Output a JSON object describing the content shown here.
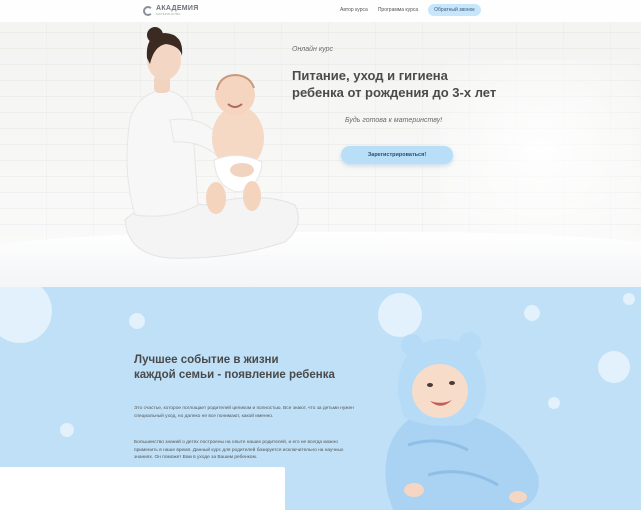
{
  "header": {
    "logo_title": "АКАДЕМИЯ",
    "logo_subtitle": "МАТЕРИНСТВА",
    "nav": [
      {
        "label": "Автор курса"
      },
      {
        "label": "Программа курса"
      }
    ],
    "cta_label": "Обратный звонок"
  },
  "hero": {
    "eyebrow": "Онлайн курс",
    "title_line1": "Питание, уход и гигиена",
    "title_line2": "ребенка от рождения до 3-х лет",
    "tagline": "Будь готова к материнству!",
    "button_label": "Зарегистрироваться!"
  },
  "section2": {
    "title_line1": "Лучшее событие в жизни",
    "title_line2": "каждой семьи - появление ребенка",
    "para1": "Это счастье, которое поглощает родителей целиком и полностью. Все знают, что за детьми нужен специальный уход, но далеко не все понимают, какой именно.",
    "para2": "Большинство знаний о детях построены на опыте наших родителей, и его не всегда можно применить в наше время. Данный курс для родителей базируется исключительно на научных знаниях. Он поможет Вам в уходе за Вашим ребенком."
  },
  "colors": {
    "accent": "#b8def8",
    "section_bg": "#bfe0f7",
    "text": "#4a4a4a"
  }
}
